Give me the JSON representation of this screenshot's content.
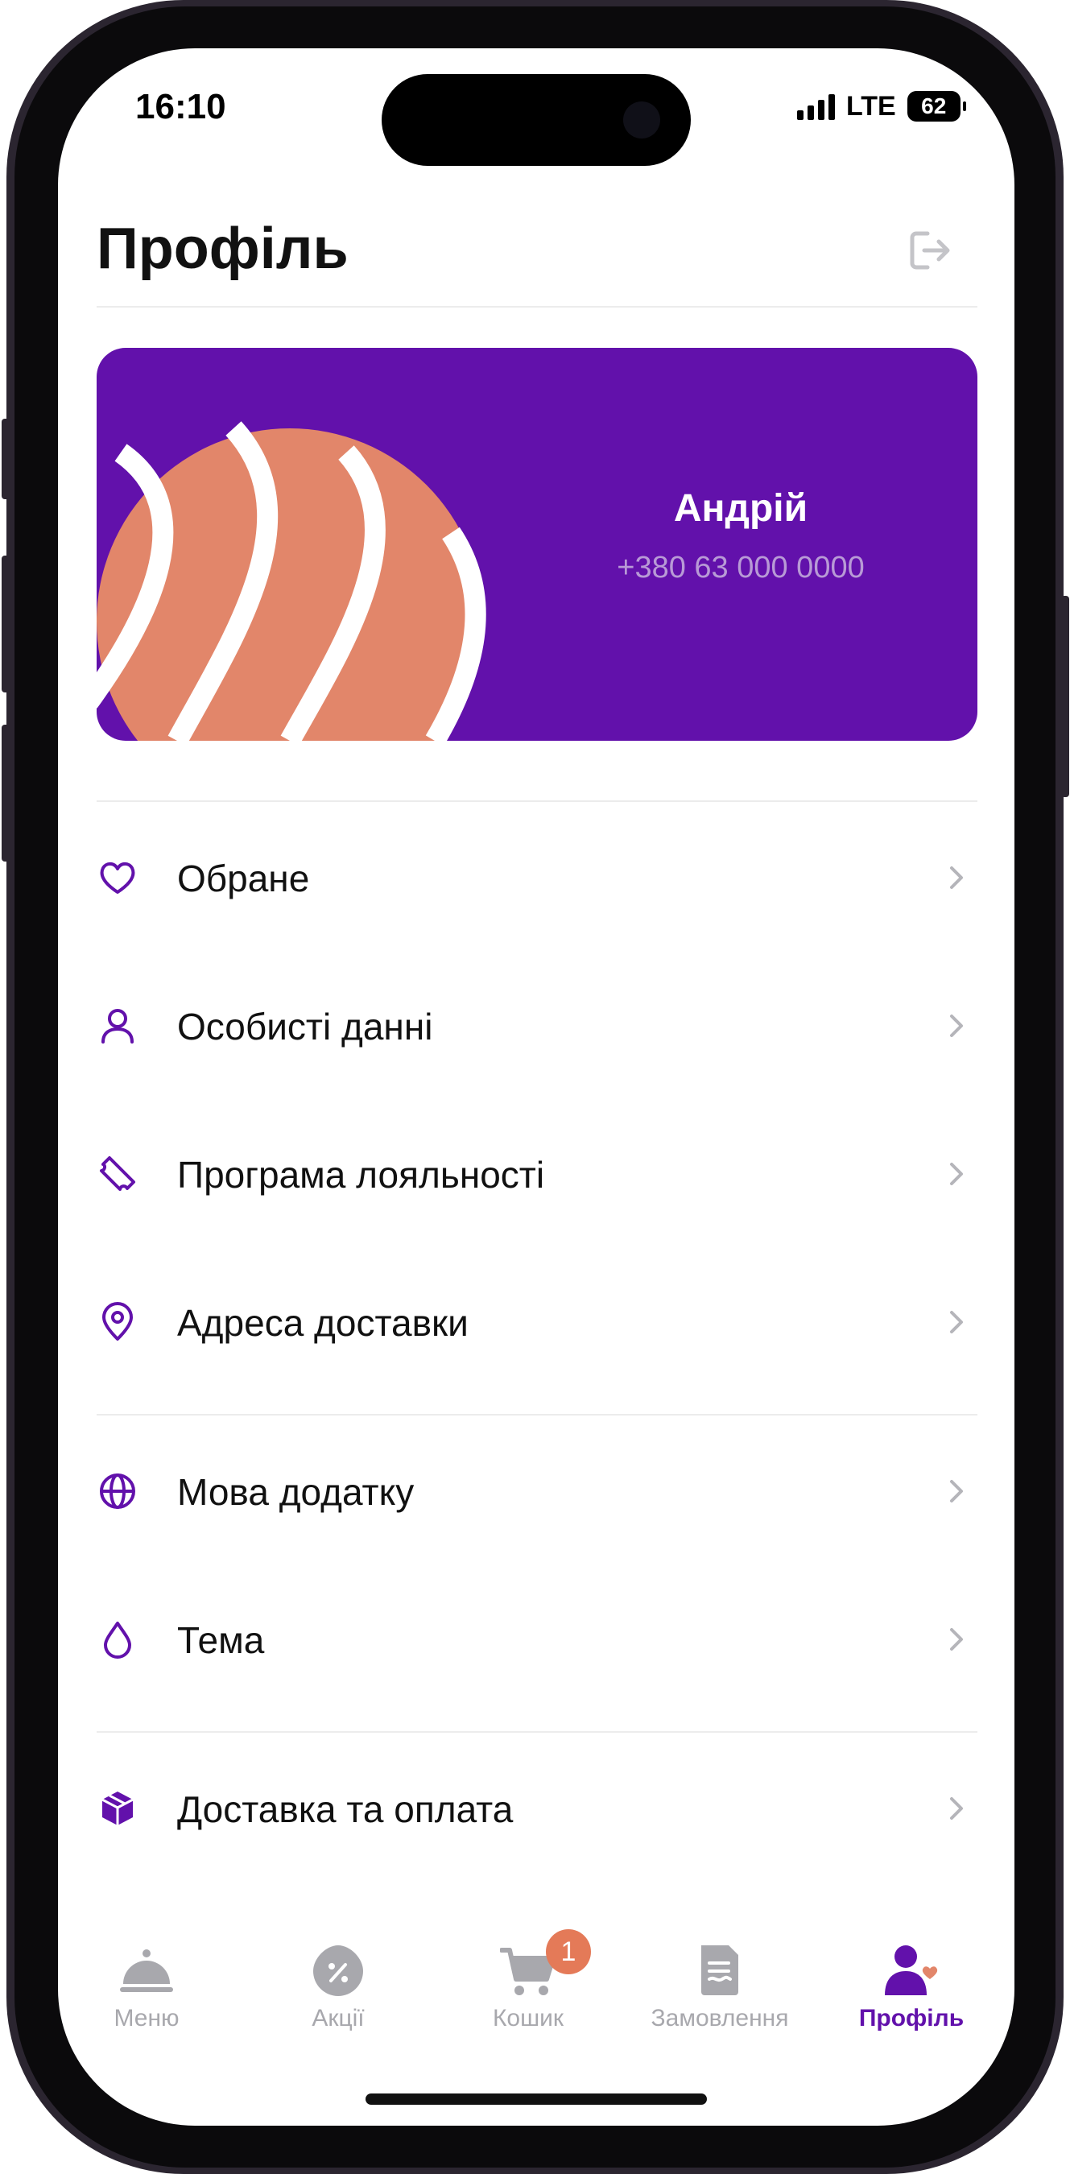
{
  "status_bar": {
    "time": "16:10",
    "network": "LTE",
    "battery": "62"
  },
  "header": {
    "title": "Профіль"
  },
  "profile_card": {
    "name": "Андрій",
    "phone": "+380 63 000 0000"
  },
  "menu": {
    "groups": [
      [
        {
          "label": "Обране",
          "icon": "heart-icon"
        },
        {
          "label": "Особисті данні",
          "icon": "user-icon"
        },
        {
          "label": "Програма лояльності",
          "icon": "ticket-icon"
        },
        {
          "label": "Адреса доставки",
          "icon": "location-pin-icon"
        }
      ],
      [
        {
          "label": "Мова додатку",
          "icon": "globe-icon"
        },
        {
          "label": "Тема",
          "icon": "drop-icon"
        }
      ],
      [
        {
          "label": "Доставка та оплата",
          "icon": "box-icon"
        }
      ]
    ]
  },
  "tabbar": {
    "tabs": [
      {
        "label": "Меню",
        "icon": "cloche-icon",
        "active": false
      },
      {
        "label": "Акції",
        "icon": "discount-icon",
        "active": false
      },
      {
        "label": "Кошик",
        "icon": "cart-icon",
        "active": false,
        "badge": "1"
      },
      {
        "label": "Замовлення",
        "icon": "receipt-icon",
        "active": false
      },
      {
        "label": "Профіль",
        "icon": "profile-icon",
        "active": true
      }
    ]
  },
  "colors": {
    "accent": "#6211ab",
    "salmon": "#e2866a",
    "badge": "#e47a58",
    "inactive": "#a8a8ad"
  }
}
